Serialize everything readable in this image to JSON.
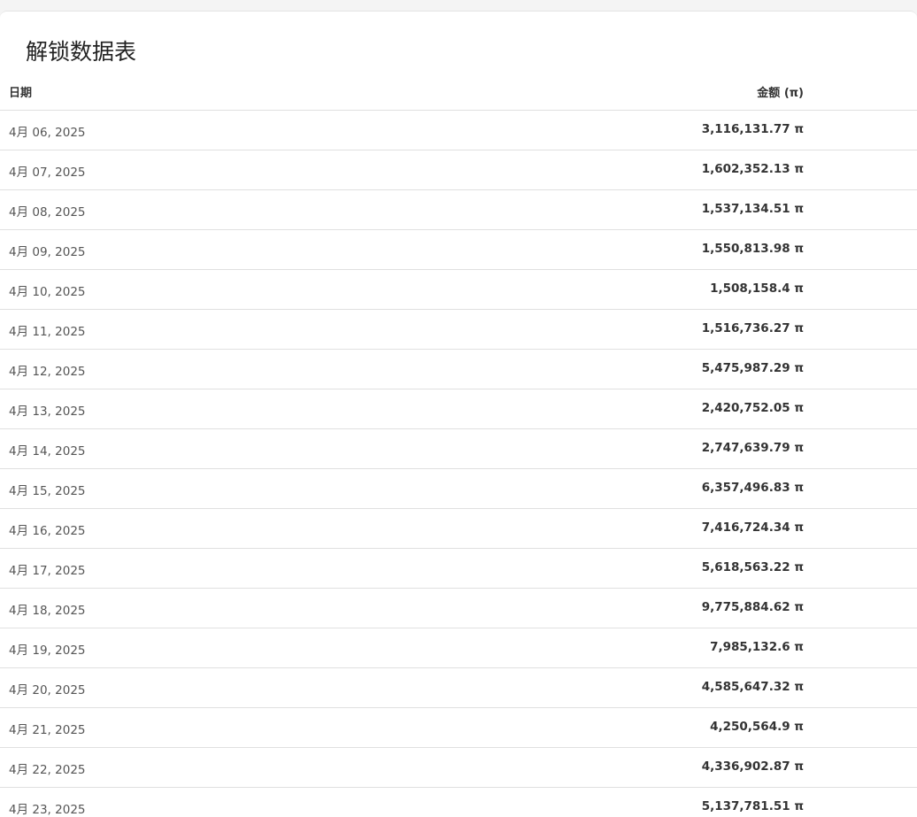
{
  "page": {
    "title": "解锁数据表"
  },
  "table": {
    "headers": {
      "date": "日期",
      "amount": "金额 (π)"
    },
    "rows": [
      {
        "date": "4月 06, 2025",
        "amount": "3,116,131.77 π"
      },
      {
        "date": "4月 07, 2025",
        "amount": "1,602,352.13 π"
      },
      {
        "date": "4月 08, 2025",
        "amount": "1,537,134.51 π"
      },
      {
        "date": "4月 09, 2025",
        "amount": "1,550,813.98 π"
      },
      {
        "date": "4月 10, 2025",
        "amount": "1,508,158.4 π"
      },
      {
        "date": "4月 11, 2025",
        "amount": "1,516,736.27 π"
      },
      {
        "date": "4月 12, 2025",
        "amount": "5,475,987.29 π"
      },
      {
        "date": "4月 13, 2025",
        "amount": "2,420,752.05 π"
      },
      {
        "date": "4月 14, 2025",
        "amount": "2,747,639.79 π"
      },
      {
        "date": "4月 15, 2025",
        "amount": "6,357,496.83 π"
      },
      {
        "date": "4月 16, 2025",
        "amount": "7,416,724.34 π"
      },
      {
        "date": "4月 17, 2025",
        "amount": "5,618,563.22 π"
      },
      {
        "date": "4月 18, 2025",
        "amount": "9,775,884.62 π"
      },
      {
        "date": "4月 19, 2025",
        "amount": "7,985,132.6 π"
      },
      {
        "date": "4月 20, 2025",
        "amount": "4,585,647.32 π"
      },
      {
        "date": "4月 21, 2025",
        "amount": "4,250,564.9 π"
      },
      {
        "date": "4月 22, 2025",
        "amount": "4,336,902.87 π"
      },
      {
        "date": "4月 23, 2025",
        "amount": "5,137,781.51 π"
      }
    ]
  }
}
